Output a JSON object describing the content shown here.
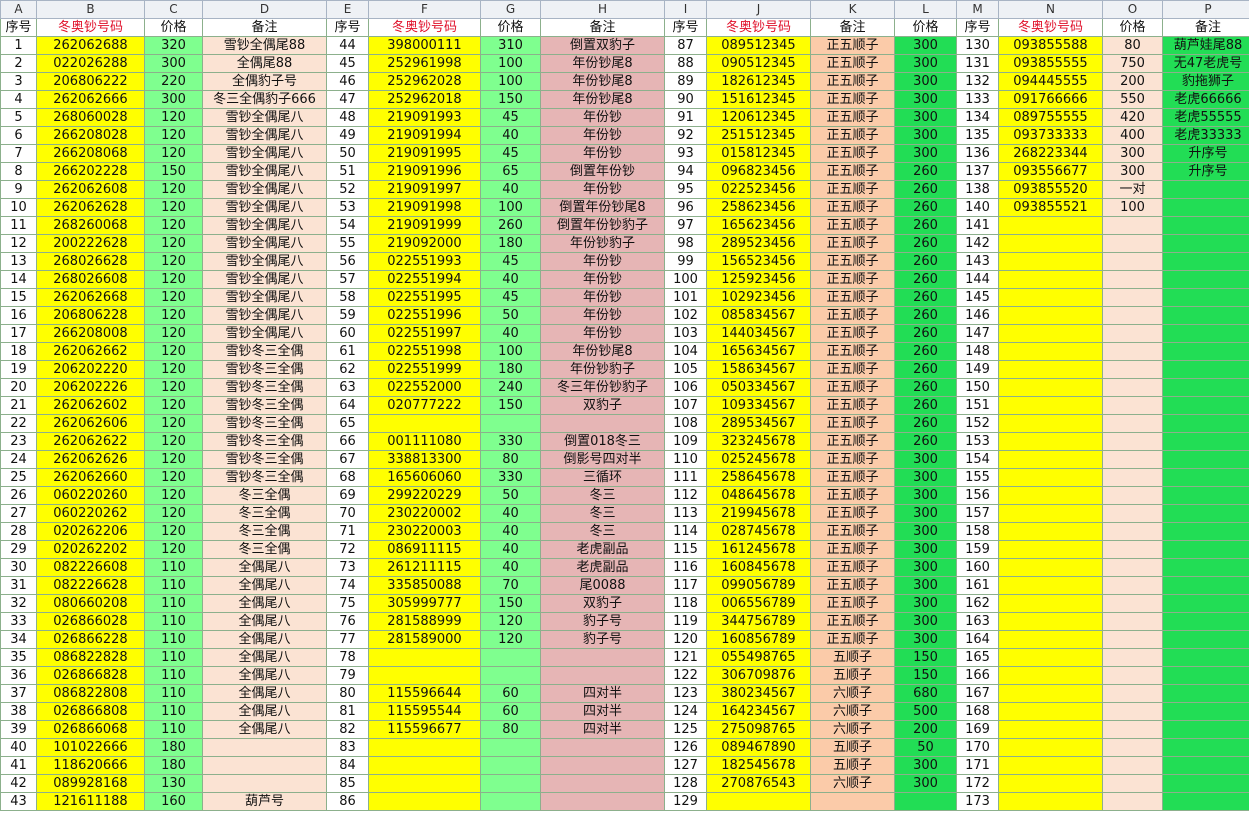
{
  "columns": [
    "A",
    "B",
    "C",
    "D",
    "E",
    "F",
    "G",
    "H",
    "I",
    "J",
    "K",
    "L",
    "M",
    "N",
    "O",
    "P"
  ],
  "headers": [
    "序号",
    "冬奥钞号码",
    "价格",
    "备注",
    "序号",
    "冬奥钞号码",
    "价格",
    "备注",
    "序号",
    "冬奥钞号码",
    "备注",
    "价格",
    "序号",
    "冬奥钞号码",
    "价格",
    "备注"
  ],
  "rows": [
    [
      "1",
      "262062688",
      "320",
      "雪钞全偶尾88",
      "44",
      "398000111",
      "310",
      "倒置双豹子",
      "87",
      "089512345",
      "正五顺子",
      "300",
      "130",
      "093855588",
      "80",
      "葫芦娃尾88"
    ],
    [
      "2",
      "022026288",
      "300",
      "全偶尾88",
      "45",
      "252961998",
      "100",
      "年份钞尾8",
      "88",
      "090512345",
      "正五顺子",
      "300",
      "131",
      "093855555",
      "750",
      "无47老虎号"
    ],
    [
      "3",
      "206806222",
      "220",
      "全偶豹子号",
      "46",
      "252962028",
      "100",
      "年份钞尾8",
      "89",
      "182612345",
      "正五顺子",
      "300",
      "132",
      "094445555",
      "200",
      "豹拖狮子"
    ],
    [
      "4",
      "262062666",
      "300",
      "冬三全偶豹子666",
      "47",
      "252962018",
      "150",
      "年份钞尾8",
      "90",
      "151612345",
      "正五顺子",
      "300",
      "133",
      "091766666",
      "550",
      "老虎66666"
    ],
    [
      "5",
      "268060028",
      "120",
      "雪钞全偶尾八",
      "48",
      "219091993",
      "45",
      "年份钞",
      "91",
      "120612345",
      "正五顺子",
      "300",
      "134",
      "089755555",
      "420",
      "老虎55555"
    ],
    [
      "6",
      "266208028",
      "120",
      "雪钞全偶尾八",
      "49",
      "219091994",
      "40",
      "年份钞",
      "92",
      "251512345",
      "正五顺子",
      "300",
      "135",
      "093733333",
      "400",
      "老虎33333"
    ],
    [
      "7",
      "266208068",
      "120",
      "雪钞全偶尾八",
      "50",
      "219091995",
      "45",
      "年份钞",
      "93",
      "015812345",
      "正五顺子",
      "300",
      "136",
      "268223344",
      "300",
      "升序号"
    ],
    [
      "8",
      "266202228",
      "150",
      "雪钞全偶尾八",
      "51",
      "219091996",
      "65",
      "倒置年份钞",
      "94",
      "096823456",
      "正五顺子",
      "260",
      "137",
      "093556677",
      "300",
      "升序号"
    ],
    [
      "9",
      "262062608",
      "120",
      "雪钞全偶尾八",
      "52",
      "219091997",
      "40",
      "年份钞",
      "95",
      "022523456",
      "正五顺子",
      "260",
      "138",
      "093855520",
      "一对",
      ""
    ],
    [
      "10",
      "262062628",
      "120",
      "雪钞全偶尾八",
      "53",
      "219091998",
      "100",
      "倒置年份钞尾8",
      "96",
      "258623456",
      "正五顺子",
      "260",
      "140",
      "093855521",
      "100",
      ""
    ],
    [
      "11",
      "268260068",
      "120",
      "雪钞全偶尾八",
      "54",
      "219091999",
      "260",
      "倒置年份钞豹子",
      "97",
      "165623456",
      "正五顺子",
      "260",
      "141",
      "",
      "",
      ""
    ],
    [
      "12",
      "200222628",
      "120",
      "雪钞全偶尾八",
      "55",
      "219092000",
      "180",
      "年份钞豹子",
      "98",
      "289523456",
      "正五顺子",
      "260",
      "142",
      "",
      "",
      ""
    ],
    [
      "13",
      "268026628",
      "120",
      "雪钞全偶尾八",
      "56",
      "022551993",
      "45",
      "年份钞",
      "99",
      "156523456",
      "正五顺子",
      "260",
      "143",
      "",
      "",
      ""
    ],
    [
      "14",
      "268026608",
      "120",
      "雪钞全偶尾八",
      "57",
      "022551994",
      "40",
      "年份钞",
      "100",
      "125923456",
      "正五顺子",
      "260",
      "144",
      "",
      "",
      ""
    ],
    [
      "15",
      "262062668",
      "120",
      "雪钞全偶尾八",
      "58",
      "022551995",
      "45",
      "年份钞",
      "101",
      "102923456",
      "正五顺子",
      "260",
      "145",
      "",
      "",
      ""
    ],
    [
      "16",
      "206806228",
      "120",
      "雪钞全偶尾八",
      "59",
      "022551996",
      "50",
      "年份钞",
      "102",
      "085834567",
      "正五顺子",
      "260",
      "146",
      "",
      "",
      ""
    ],
    [
      "17",
      "266208008",
      "120",
      "雪钞全偶尾八",
      "60",
      "022551997",
      "40",
      "年份钞",
      "103",
      "144034567",
      "正五顺子",
      "260",
      "147",
      "",
      "",
      ""
    ],
    [
      "18",
      "262062662",
      "120",
      "雪钞冬三全偶",
      "61",
      "022551998",
      "100",
      "年份钞尾8",
      "104",
      "165634567",
      "正五顺子",
      "260",
      "148",
      "",
      "",
      ""
    ],
    [
      "19",
      "206202220",
      "120",
      "雪钞冬三全偶",
      "62",
      "022551999",
      "180",
      "年份钞豹子",
      "105",
      "158634567",
      "正五顺子",
      "260",
      "149",
      "",
      "",
      ""
    ],
    [
      "20",
      "206202226",
      "120",
      "雪钞冬三全偶",
      "63",
      "022552000",
      "240",
      "冬三年份钞豹子",
      "106",
      "050334567",
      "正五顺子",
      "260",
      "150",
      "",
      "",
      ""
    ],
    [
      "21",
      "262062602",
      "120",
      "雪钞冬三全偶",
      "64",
      "020777222",
      "150",
      "双豹子",
      "107",
      "109334567",
      "正五顺子",
      "260",
      "151",
      "",
      "",
      ""
    ],
    [
      "22",
      "262062606",
      "120",
      "雪钞冬三全偶",
      "65",
      "",
      "",
      "",
      "108",
      "289534567",
      "正五顺子",
      "260",
      "152",
      "",
      "",
      ""
    ],
    [
      "23",
      "262062622",
      "120",
      "雪钞冬三全偶",
      "66",
      "001111080",
      "330",
      "倒置018冬三",
      "109",
      "323245678",
      "正五顺子",
      "260",
      "153",
      "",
      "",
      ""
    ],
    [
      "24",
      "262062626",
      "120",
      "雪钞冬三全偶",
      "67",
      "338813300",
      "80",
      "倒影号四对半",
      "110",
      "025245678",
      "正五顺子",
      "300",
      "154",
      "",
      "",
      ""
    ],
    [
      "25",
      "262062660",
      "120",
      "雪钞冬三全偶",
      "68",
      "165606060",
      "330",
      "三循环",
      "111",
      "258645678",
      "正五顺子",
      "300",
      "155",
      "",
      "",
      ""
    ],
    [
      "26",
      "060220260",
      "120",
      "冬三全偶",
      "69",
      "299220229",
      "50",
      "冬三",
      "112",
      "048645678",
      "正五顺子",
      "300",
      "156",
      "",
      "",
      ""
    ],
    [
      "27",
      "060220262",
      "120",
      "冬三全偶",
      "70",
      "230220002",
      "40",
      "冬三",
      "113",
      "219945678",
      "正五顺子",
      "300",
      "157",
      "",
      "",
      ""
    ],
    [
      "28",
      "020262206",
      "120",
      "冬三全偶",
      "71",
      "230220003",
      "40",
      "冬三",
      "114",
      "028745678",
      "正五顺子",
      "300",
      "158",
      "",
      "",
      ""
    ],
    [
      "29",
      "020262202",
      "120",
      "冬三全偶",
      "72",
      "086911115",
      "40",
      "老虎副品",
      "115",
      "161245678",
      "正五顺子",
      "300",
      "159",
      "",
      "",
      ""
    ],
    [
      "30",
      "082226608",
      "110",
      "全偶尾八",
      "73",
      "261211115",
      "40",
      "老虎副品",
      "116",
      "160845678",
      "正五顺子",
      "300",
      "160",
      "",
      "",
      ""
    ],
    [
      "31",
      "082226628",
      "110",
      "全偶尾八",
      "74",
      "335850088",
      "70",
      "尾0088",
      "117",
      "099056789",
      "正五顺子",
      "300",
      "161",
      "",
      "",
      ""
    ],
    [
      "32",
      "080660208",
      "110",
      "全偶尾八",
      "75",
      "305999777",
      "150",
      "双豹子",
      "118",
      "006556789",
      "正五顺子",
      "300",
      "162",
      "",
      "",
      ""
    ],
    [
      "33",
      "026866028",
      "110",
      "全偶尾八",
      "76",
      "281588999",
      "120",
      "豹子号",
      "119",
      "344756789",
      "正五顺子",
      "300",
      "163",
      "",
      "",
      ""
    ],
    [
      "34",
      "026866228",
      "110",
      "全偶尾八",
      "77",
      "281589000",
      "120",
      "豹子号",
      "120",
      "160856789",
      "正五顺子",
      "300",
      "164",
      "",
      "",
      ""
    ],
    [
      "35",
      "086822828",
      "110",
      "全偶尾八",
      "78",
      "",
      "",
      "",
      "121",
      "055498765",
      "五顺子",
      "150",
      "165",
      "",
      "",
      ""
    ],
    [
      "36",
      "026866828",
      "110",
      "全偶尾八",
      "79",
      "",
      "",
      "",
      "122",
      "306709876",
      "五顺子",
      "150",
      "166",
      "",
      "",
      ""
    ],
    [
      "37",
      "086822808",
      "110",
      "全偶尾八",
      "80",
      "115596644",
      "60",
      "四对半",
      "123",
      "380234567",
      "六顺子",
      "680",
      "167",
      "",
      "",
      ""
    ],
    [
      "38",
      "026866808",
      "110",
      "全偶尾八",
      "81",
      "115595544",
      "60",
      "四对半",
      "124",
      "164234567",
      "六顺子",
      "500",
      "168",
      "",
      "",
      ""
    ],
    [
      "39",
      "026866068",
      "110",
      "全偶尾八",
      "82",
      "115596677",
      "80",
      "四对半",
      "125",
      "275098765",
      "六顺子",
      "200",
      "169",
      "",
      "",
      ""
    ],
    [
      "40",
      "101022666",
      "180",
      "",
      "83",
      "",
      "",
      "",
      "126",
      "089467890",
      "五顺子",
      "50",
      "170",
      "",
      "",
      ""
    ],
    [
      "41",
      "118620666",
      "180",
      "",
      "84",
      "",
      "",
      "",
      "127",
      "182545678",
      "五顺子",
      "300",
      "171",
      "",
      "",
      ""
    ],
    [
      "42",
      "089928168",
      "130",
      "",
      "85",
      "",
      "",
      "",
      "128",
      "270876543",
      "六顺子",
      "300",
      "172",
      "",
      "",
      ""
    ],
    [
      "43",
      "121611188",
      "160",
      "葫芦号",
      "86",
      "",
      "",
      "",
      "129",
      "",
      "",
      "",
      "173",
      "",
      "",
      ""
    ]
  ]
}
